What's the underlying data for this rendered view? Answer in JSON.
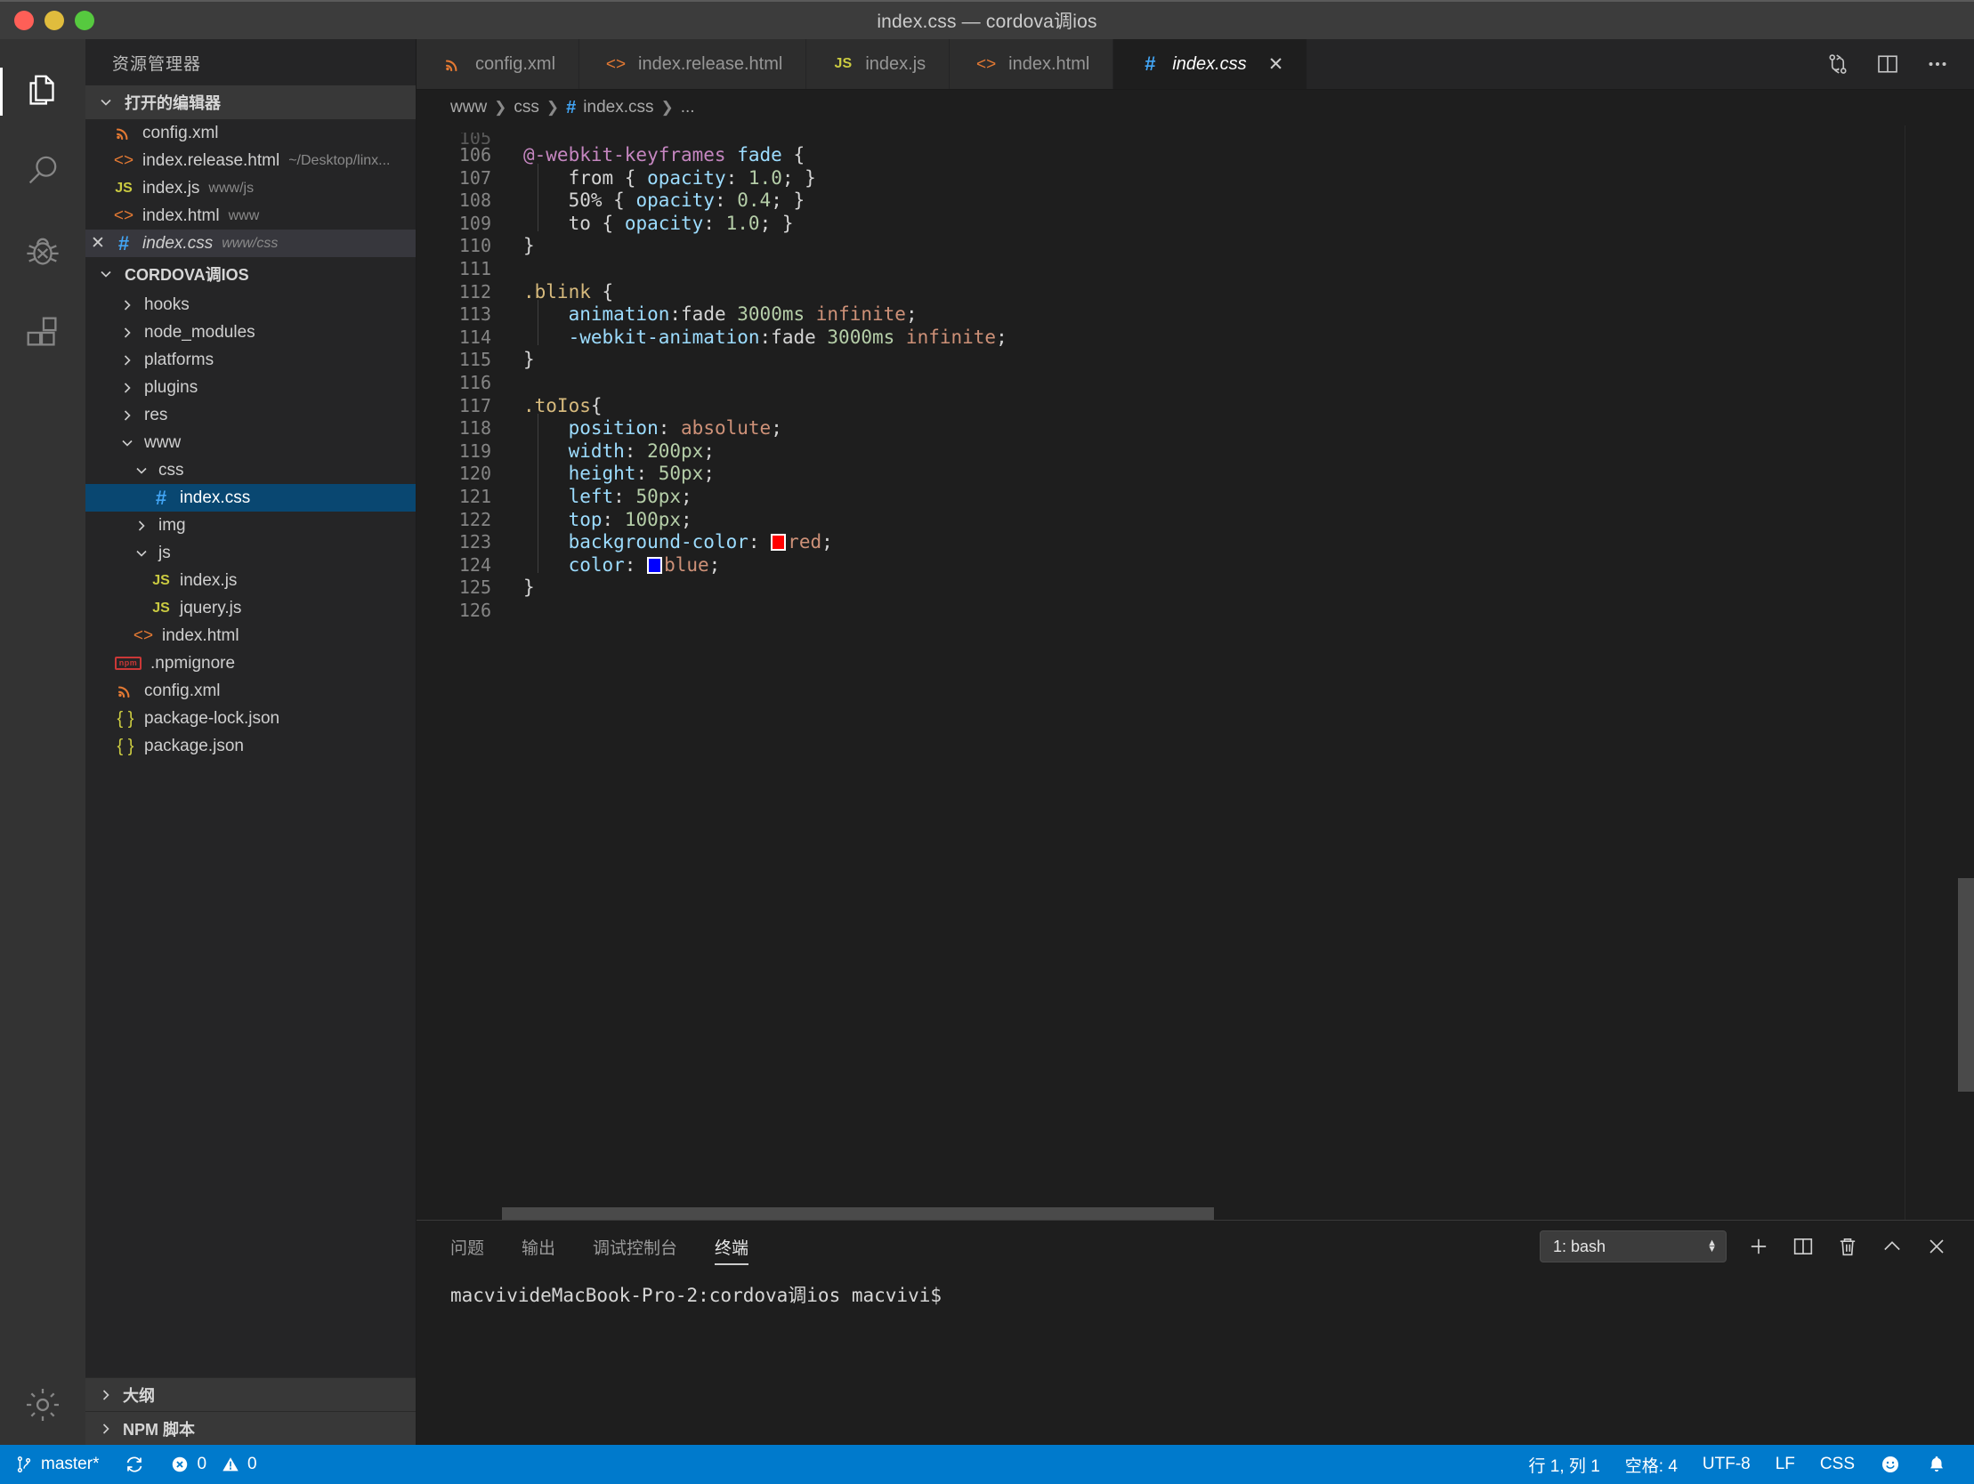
{
  "window": {
    "title": "index.css — cordova调ios",
    "traffic_lights": [
      "close-red",
      "minimize-yellow",
      "maximize-green"
    ]
  },
  "activitybar": {
    "items": [
      {
        "name": "explorer",
        "icon": "files-icon",
        "active": true
      },
      {
        "name": "search",
        "icon": "search-icon",
        "active": false
      },
      {
        "name": "debug",
        "icon": "debug-icon",
        "active": false
      },
      {
        "name": "extensions",
        "icon": "extensions-icon",
        "active": false
      }
    ],
    "settings_icon": "gear-icon"
  },
  "sidebar": {
    "title": "资源管理器",
    "open_editors": {
      "header": "打开的编辑器",
      "items": [
        {
          "icon": "xml",
          "name": "config.xml",
          "path": "",
          "dirty": false,
          "selected": false,
          "italic": false
        },
        {
          "icon": "html",
          "name": "index.release.html",
          "path": "~/Desktop/linx...",
          "selected": false,
          "italic": false
        },
        {
          "icon": "js",
          "name": "index.js",
          "path": "www/js",
          "selected": false,
          "italic": false
        },
        {
          "icon": "html",
          "name": "index.html",
          "path": "www",
          "selected": false,
          "italic": false
        },
        {
          "icon": "css",
          "name": "index.css",
          "path": "www/css",
          "selected": true,
          "italic": true,
          "close_label": "✕"
        }
      ]
    },
    "project": {
      "header": "CORDOVA调IOS",
      "tree": [
        {
          "kind": "folder",
          "label": "hooks",
          "expanded": false,
          "depth": 1
        },
        {
          "kind": "folder",
          "label": "node_modules",
          "expanded": false,
          "depth": 1
        },
        {
          "kind": "folder",
          "label": "platforms",
          "expanded": false,
          "depth": 1
        },
        {
          "kind": "folder",
          "label": "plugins",
          "expanded": false,
          "depth": 1
        },
        {
          "kind": "folder",
          "label": "res",
          "expanded": false,
          "depth": 1
        },
        {
          "kind": "folder",
          "label": "www",
          "expanded": true,
          "depth": 1
        },
        {
          "kind": "folder",
          "label": "css",
          "expanded": true,
          "depth": 2
        },
        {
          "kind": "file",
          "icon": "css",
          "label": "index.css",
          "depth": 3,
          "selected": true
        },
        {
          "kind": "folder",
          "label": "img",
          "expanded": false,
          "depth": 2
        },
        {
          "kind": "folder",
          "label": "js",
          "expanded": true,
          "depth": 2
        },
        {
          "kind": "file",
          "icon": "js",
          "label": "index.js",
          "depth": 3
        },
        {
          "kind": "file",
          "icon": "js",
          "label": "jquery.js",
          "depth": 3
        },
        {
          "kind": "file",
          "icon": "html",
          "label": "index.html",
          "depth": 2
        },
        {
          "kind": "file",
          "icon": "npm",
          "label": ".npmignore",
          "depth": 1
        },
        {
          "kind": "file",
          "icon": "xml",
          "label": "config.xml",
          "depth": 1
        },
        {
          "kind": "file",
          "icon": "json",
          "label": "package-lock.json",
          "depth": 1
        },
        {
          "kind": "file",
          "icon": "json",
          "label": "package.json",
          "depth": 1
        }
      ]
    },
    "bottom_sections": [
      {
        "label": "大纲",
        "expanded": false
      },
      {
        "label": "NPM 脚本",
        "expanded": false
      }
    ]
  },
  "editor": {
    "tabs": [
      {
        "icon": "xml",
        "label": "config.xml",
        "active": false,
        "italic": false
      },
      {
        "icon": "html",
        "label": "index.release.html",
        "active": false,
        "italic": false
      },
      {
        "icon": "js",
        "label": "index.js",
        "active": false,
        "italic": false
      },
      {
        "icon": "html",
        "label": "index.html",
        "active": false,
        "italic": false
      },
      {
        "icon": "css",
        "label": "index.css",
        "active": true,
        "italic": true,
        "close_label": "✕"
      }
    ],
    "tab_actions": [
      {
        "name": "split-changes-icon"
      },
      {
        "name": "split-editor-icon"
      },
      {
        "name": "more-actions-icon"
      }
    ],
    "breadcrumb": [
      "www",
      "css",
      "index.css",
      "..."
    ],
    "first_partial_line": "105",
    "lines": [
      {
        "n": "106",
        "indent": 0,
        "guide": false,
        "tokens": [
          {
            "t": "@-webkit-keyframes",
            "c": "at"
          },
          {
            "t": " ",
            "c": "plain"
          },
          {
            "t": "fade",
            "c": "prop"
          },
          {
            "t": " {",
            "c": "plain"
          }
        ]
      },
      {
        "n": "107",
        "indent": 1,
        "guide": true,
        "tokens": [
          {
            "t": "from",
            "c": "plain"
          },
          {
            "t": " { ",
            "c": "plain"
          },
          {
            "t": "opacity",
            "c": "prop"
          },
          {
            "t": ": ",
            "c": "plain"
          },
          {
            "t": "1.0",
            "c": "num"
          },
          {
            "t": "; }",
            "c": "plain"
          }
        ]
      },
      {
        "n": "108",
        "indent": 1,
        "guide": true,
        "tokens": [
          {
            "t": "50%",
            "c": "plain"
          },
          {
            "t": " { ",
            "c": "plain"
          },
          {
            "t": "opacity",
            "c": "prop"
          },
          {
            "t": ": ",
            "c": "plain"
          },
          {
            "t": "0.4",
            "c": "num"
          },
          {
            "t": "; }",
            "c": "plain"
          }
        ]
      },
      {
        "n": "109",
        "indent": 1,
        "guide": true,
        "tokens": [
          {
            "t": "to",
            "c": "plain"
          },
          {
            "t": " { ",
            "c": "plain"
          },
          {
            "t": "opacity",
            "c": "prop"
          },
          {
            "t": ": ",
            "c": "plain"
          },
          {
            "t": "1.0",
            "c": "num"
          },
          {
            "t": "; }",
            "c": "plain"
          }
        ]
      },
      {
        "n": "110",
        "indent": 0,
        "guide": false,
        "tokens": [
          {
            "t": "}",
            "c": "plain"
          }
        ]
      },
      {
        "n": "111",
        "indent": 0,
        "guide": false,
        "tokens": []
      },
      {
        "n": "112",
        "indent": 0,
        "guide": false,
        "tokens": [
          {
            "t": ".blink",
            "c": "sel"
          },
          {
            "t": " {",
            "c": "plain"
          }
        ]
      },
      {
        "n": "113",
        "indent": 1,
        "guide": true,
        "tokens": [
          {
            "t": "animation",
            "c": "prop"
          },
          {
            "t": ":",
            "c": "plain"
          },
          {
            "t": "fade",
            "c": "plain"
          },
          {
            "t": " ",
            "c": "plain"
          },
          {
            "t": "3000ms",
            "c": "num"
          },
          {
            "t": " ",
            "c": "plain"
          },
          {
            "t": "infinite",
            "c": "val"
          },
          {
            "t": ";",
            "c": "plain"
          }
        ]
      },
      {
        "n": "114",
        "indent": 1,
        "guide": true,
        "tokens": [
          {
            "t": "-webkit-animation",
            "c": "prop"
          },
          {
            "t": ":",
            "c": "plain"
          },
          {
            "t": "fade",
            "c": "plain"
          },
          {
            "t": " ",
            "c": "plain"
          },
          {
            "t": "3000ms",
            "c": "num"
          },
          {
            "t": " ",
            "c": "plain"
          },
          {
            "t": "infinite",
            "c": "val"
          },
          {
            "t": ";",
            "c": "plain"
          }
        ]
      },
      {
        "n": "115",
        "indent": 0,
        "guide": false,
        "tokens": [
          {
            "t": "}",
            "c": "plain"
          }
        ]
      },
      {
        "n": "116",
        "indent": 0,
        "guide": false,
        "tokens": []
      },
      {
        "n": "117",
        "indent": 0,
        "guide": false,
        "tokens": [
          {
            "t": ".toIos",
            "c": "sel"
          },
          {
            "t": "{",
            "c": "plain"
          }
        ]
      },
      {
        "n": "118",
        "indent": 1,
        "guide": true,
        "tokens": [
          {
            "t": "position",
            "c": "prop"
          },
          {
            "t": ": ",
            "c": "plain"
          },
          {
            "t": "absolute",
            "c": "val"
          },
          {
            "t": ";",
            "c": "plain"
          }
        ]
      },
      {
        "n": "119",
        "indent": 1,
        "guide": true,
        "tokens": [
          {
            "t": "width",
            "c": "prop"
          },
          {
            "t": ": ",
            "c": "plain"
          },
          {
            "t": "200px",
            "c": "num"
          },
          {
            "t": ";",
            "c": "plain"
          }
        ]
      },
      {
        "n": "120",
        "indent": 1,
        "guide": true,
        "tokens": [
          {
            "t": "height",
            "c": "prop"
          },
          {
            "t": ": ",
            "c": "plain"
          },
          {
            "t": "50px",
            "c": "num"
          },
          {
            "t": ";",
            "c": "plain"
          }
        ]
      },
      {
        "n": "121",
        "indent": 1,
        "guide": true,
        "tokens": [
          {
            "t": "left",
            "c": "prop"
          },
          {
            "t": ": ",
            "c": "plain"
          },
          {
            "t": "50px",
            "c": "num"
          },
          {
            "t": ";",
            "c": "plain"
          }
        ]
      },
      {
        "n": "122",
        "indent": 1,
        "guide": true,
        "tokens": [
          {
            "t": "top",
            "c": "prop"
          },
          {
            "t": ": ",
            "c": "plain"
          },
          {
            "t": "100px",
            "c": "num"
          },
          {
            "t": ";",
            "c": "plain"
          }
        ]
      },
      {
        "n": "123",
        "indent": 1,
        "guide": true,
        "tokens": [
          {
            "t": "background-color",
            "c": "prop"
          },
          {
            "t": ": ",
            "c": "plain"
          },
          {
            "t": "",
            "c": "swatch",
            "swatch": "#ff0000"
          },
          {
            "t": "red",
            "c": "val"
          },
          {
            "t": ";",
            "c": "plain"
          }
        ]
      },
      {
        "n": "124",
        "indent": 1,
        "guide": true,
        "tokens": [
          {
            "t": "color",
            "c": "prop"
          },
          {
            "t": ": ",
            "c": "plain"
          },
          {
            "t": "",
            "c": "swatch",
            "swatch": "#0000ff"
          },
          {
            "t": "blue",
            "c": "val"
          },
          {
            "t": ";",
            "c": "plain"
          }
        ]
      },
      {
        "n": "125",
        "indent": 0,
        "guide": false,
        "tokens": [
          {
            "t": "}",
            "c": "plain"
          }
        ]
      },
      {
        "n": "126",
        "indent": 0,
        "guide": false,
        "tokens": []
      }
    ]
  },
  "panel": {
    "tabs": [
      {
        "label": "问题",
        "active": false
      },
      {
        "label": "输出",
        "active": false
      },
      {
        "label": "调试控制台",
        "active": false
      },
      {
        "label": "终端",
        "active": true
      }
    ],
    "terminal_select": "1: bash",
    "actions": [
      {
        "name": "new-terminal-icon"
      },
      {
        "name": "split-terminal-icon"
      },
      {
        "name": "kill-terminal-icon"
      },
      {
        "name": "maximize-panel-icon"
      },
      {
        "name": "close-panel-icon"
      }
    ],
    "terminal_line": "macvivideMacBook-Pro-2:cordova调ios macvivi$"
  },
  "statusbar": {
    "branch": "master*",
    "sync_icon": "sync-icon",
    "errors": "0",
    "warnings": "0",
    "cursor": "行 1, 列 1",
    "indent": "空格: 4",
    "encoding": "UTF-8",
    "eol": "LF",
    "language": "CSS",
    "feedback_icon": "smiley-icon",
    "bell_icon": "bell-icon",
    "accent": "#007acc"
  }
}
